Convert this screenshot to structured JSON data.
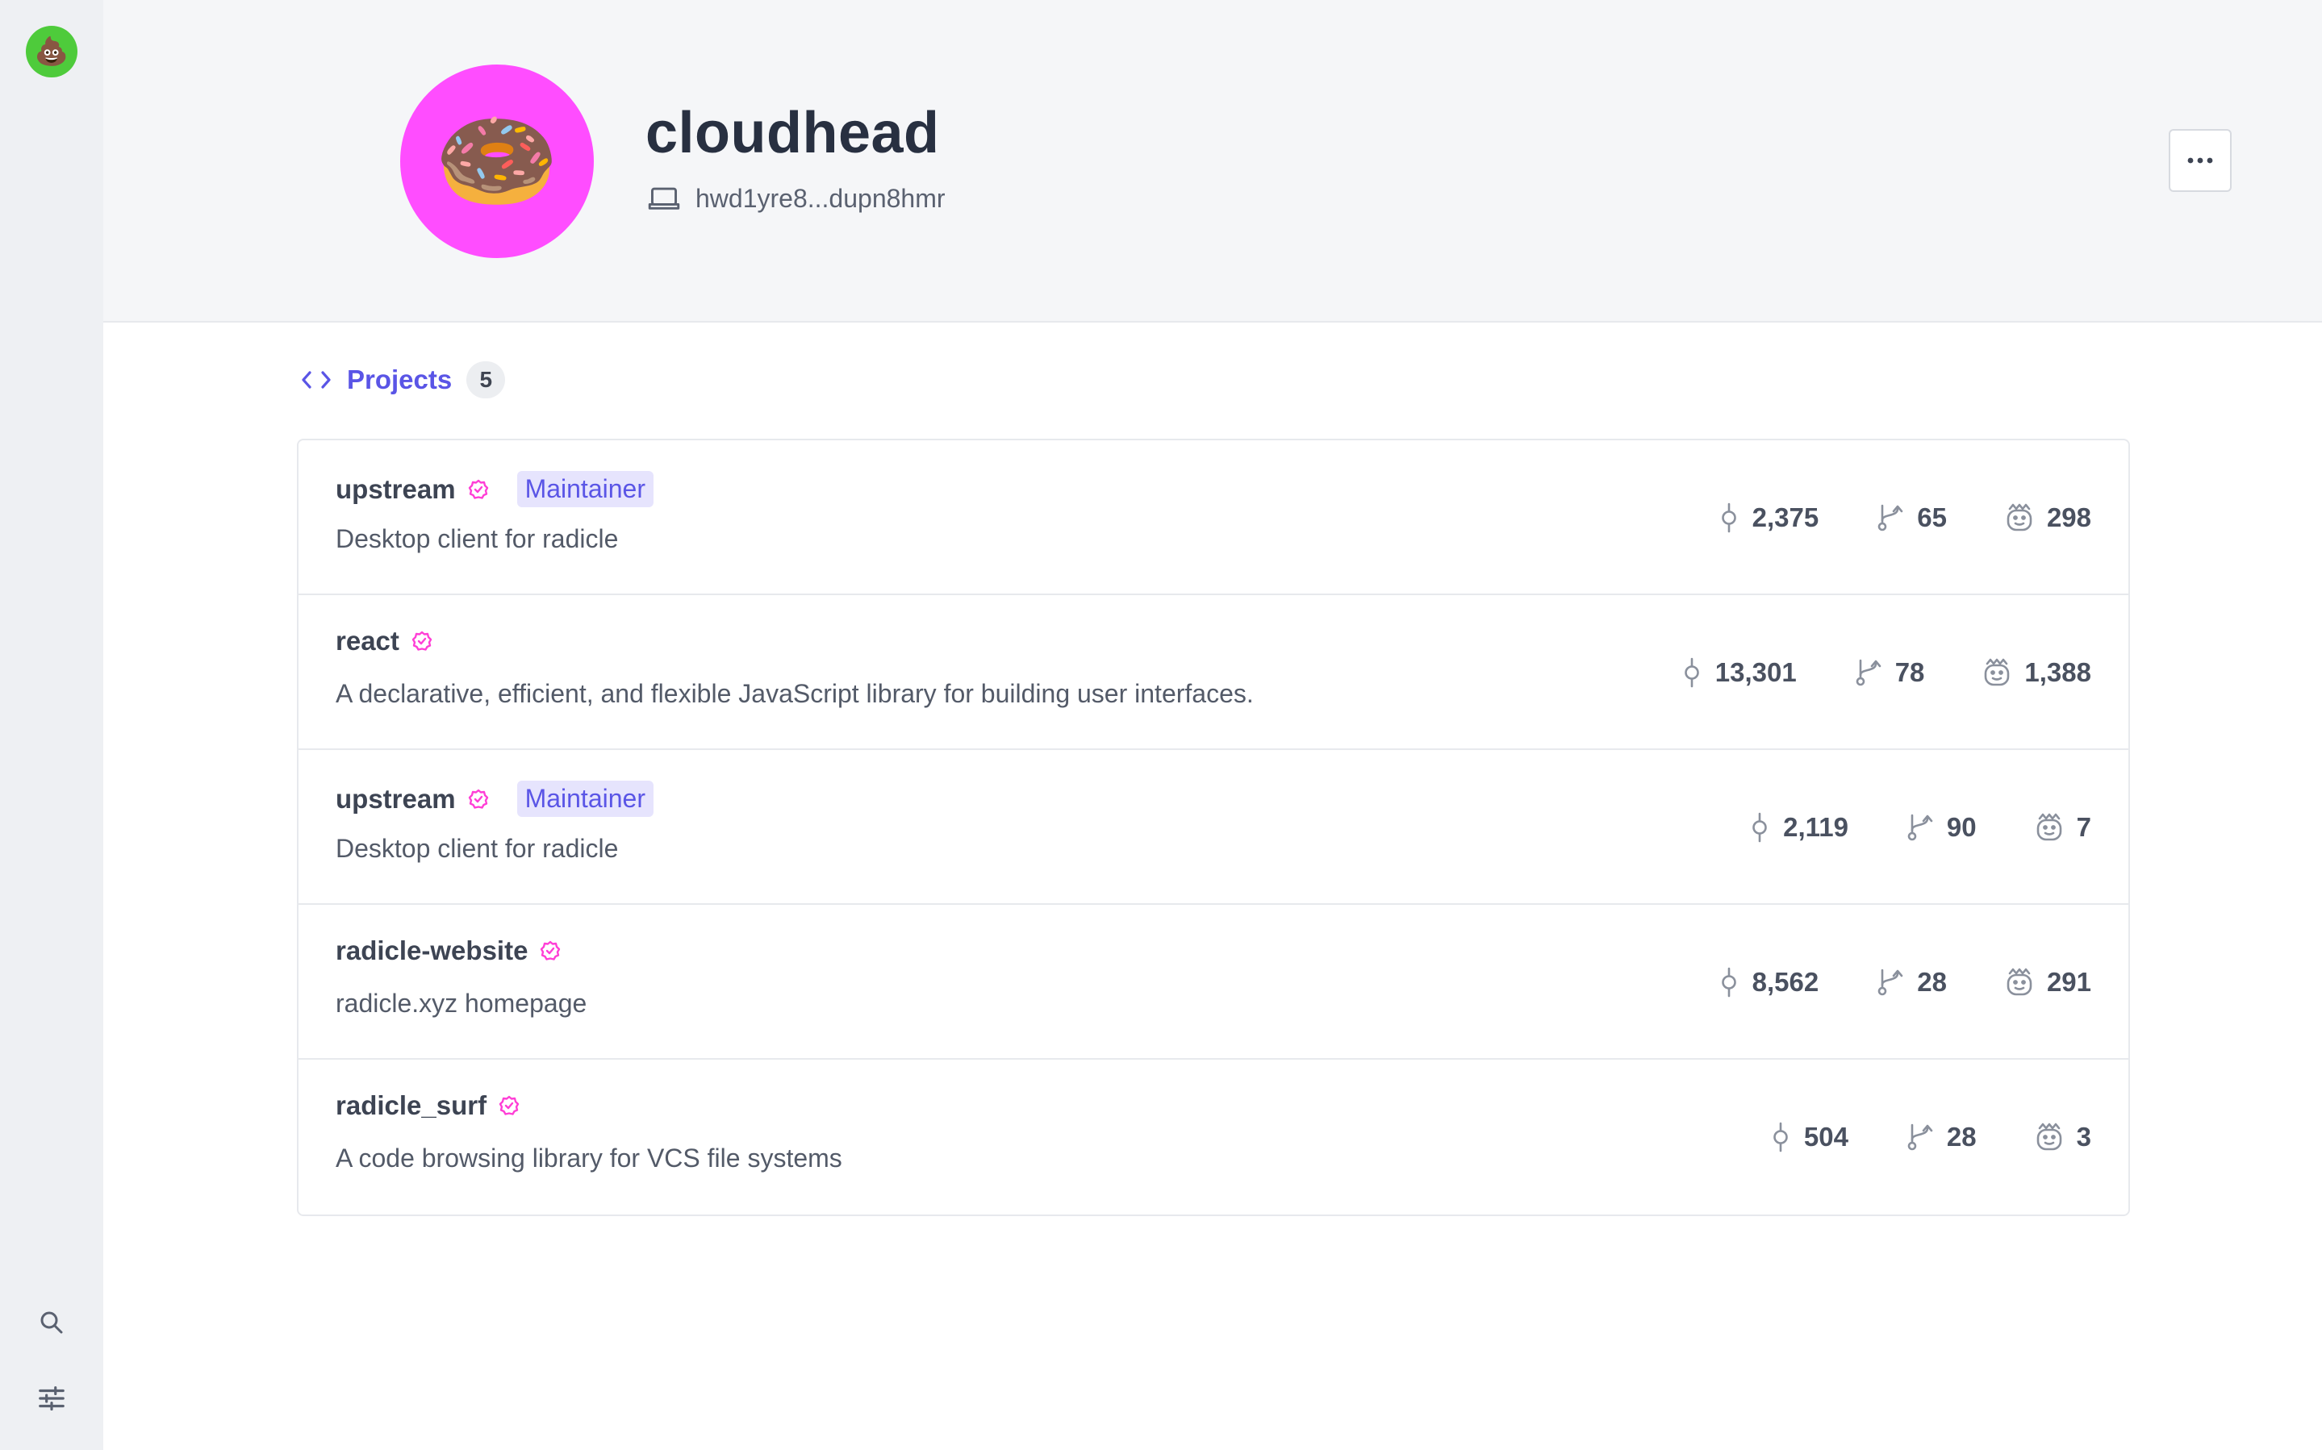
{
  "sidebar": {
    "avatar_emoji": "💩",
    "icons": [
      "search-icon",
      "settings-sliders-icon"
    ]
  },
  "header": {
    "avatar_emoji": "🍩",
    "avatar_color": "#ff4dff",
    "name": "cloudhead",
    "device_id": "hwd1yre8...dupn8hmr",
    "more_label": "•••"
  },
  "projects": {
    "label": "Projects",
    "count": "5",
    "items": [
      {
        "name": "upstream",
        "badge": "Maintainer",
        "description": "Desktop client for radicle",
        "commits": "2,375",
        "branches": "65",
        "contributors": "298"
      },
      {
        "name": "react",
        "badge": "",
        "description": "A declarative, efficient, and flexible JavaScript library for building user interfaces.",
        "commits": "13,301",
        "branches": "78",
        "contributors": "1,388"
      },
      {
        "name": "upstream",
        "badge": "Maintainer",
        "description": "Desktop client for radicle",
        "commits": "2,119",
        "branches": "90",
        "contributors": "7"
      },
      {
        "name": "radicle-website",
        "badge": "",
        "description": "radicle.xyz homepage",
        "commits": "8,562",
        "branches": "28",
        "contributors": "291"
      },
      {
        "name": "radicle_surf",
        "badge": "",
        "description": "A code browsing library for VCS file systems",
        "commits": "504",
        "branches": "28",
        "contributors": "3"
      }
    ]
  },
  "colors": {
    "accent": "#5a55e6",
    "verified": "#ff3fd6",
    "badge_bg": "#e6e4fd"
  }
}
